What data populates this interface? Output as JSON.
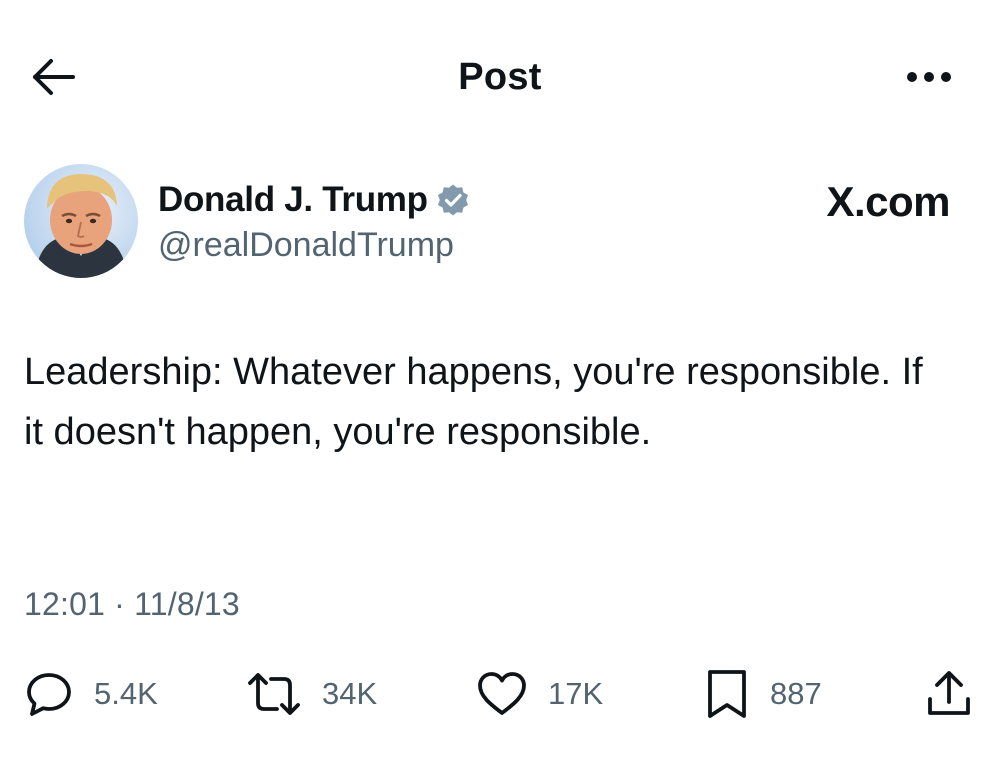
{
  "header": {
    "title": "Post",
    "back_icon": "arrow-left-icon",
    "more_icon": "more-horizontal-icon"
  },
  "author": {
    "name": "Donald J. Trump",
    "handle": "@realDonaldTrump",
    "verified_icon": "verified-badge-icon",
    "verified_color": "#829aab"
  },
  "brand": {
    "label": "X.com"
  },
  "post": {
    "text": "Leadership: Whatever happens, you're responsible. If it doesn't happen, you're responsible.",
    "timestamp": "12:01 · 11/8/13"
  },
  "actions": {
    "reply": {
      "icon": "reply-icon",
      "count": "5.4K"
    },
    "repost": {
      "icon": "repost-icon",
      "count": "34K"
    },
    "like": {
      "icon": "heart-icon",
      "count": "17K"
    },
    "bookmark": {
      "icon": "bookmark-icon",
      "count": "887"
    },
    "share": {
      "icon": "share-icon"
    }
  },
  "colors": {
    "text": "#0f1419",
    "secondary": "#536471",
    "background": "#ffffff"
  }
}
